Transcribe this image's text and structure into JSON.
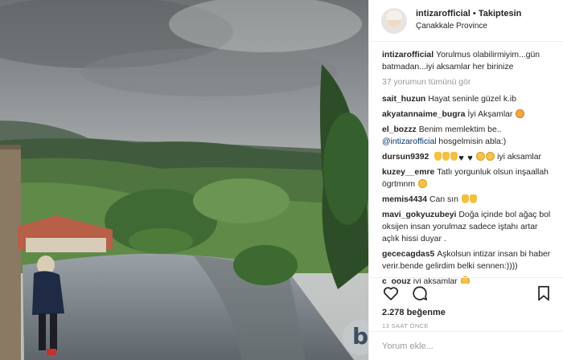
{
  "post": {
    "username": "intizarofficial",
    "separator": " • ",
    "follow_label": "Takiptesin",
    "location": "Çanakkale Province"
  },
  "caption": {
    "username": "intizarofficial",
    "text": "Yorulmus olabilirmiyim...gün batmadan...iyi aksamlar her birinize"
  },
  "view_all_comments": "37 yorumun tümünü gör",
  "comments": [
    {
      "user": "sait_huzun",
      "text": "Hayat seninle güzel k.ib"
    },
    {
      "user": "akyatannaime_bugra",
      "text": "İyi Akşamlar"
    },
    {
      "user": "el_bozzz",
      "text": "Benim memlektim be..",
      "mention": "@intizarofficial",
      "after": " hosgelmisin abla:)"
    },
    {
      "user": "dursun9392",
      "text": "iyi aksamlar"
    },
    {
      "user": "kuzey__emre",
      "text": "Tatlı yorgunluk olsun inşaallah ögrtmnm"
    },
    {
      "user": "memis4434",
      "text": "Can sın"
    },
    {
      "user": "mavi_gokyuzubeyi",
      "text": "Doğa içinde bol ağaç bol oksijen insan yorulmaz sadece iştahı artar açlık hissi duyar ."
    },
    {
      "user": "gececagdas5",
      "text": "Aşkolsun intizar insan bi haber verir.bende gelirdim belki sennen:))))"
    },
    {
      "user": "c_oouz",
      "text": "iyi aksamlar"
    }
  ],
  "actions": {
    "likes": "2.278 beğenme",
    "time": "13 SAAT ÖNCE"
  },
  "add_comment": {
    "placeholder": "Yorum ekle..."
  },
  "watermark": "b",
  "icons": [
    "heart-icon",
    "comment-icon",
    "bookmark-icon"
  ]
}
